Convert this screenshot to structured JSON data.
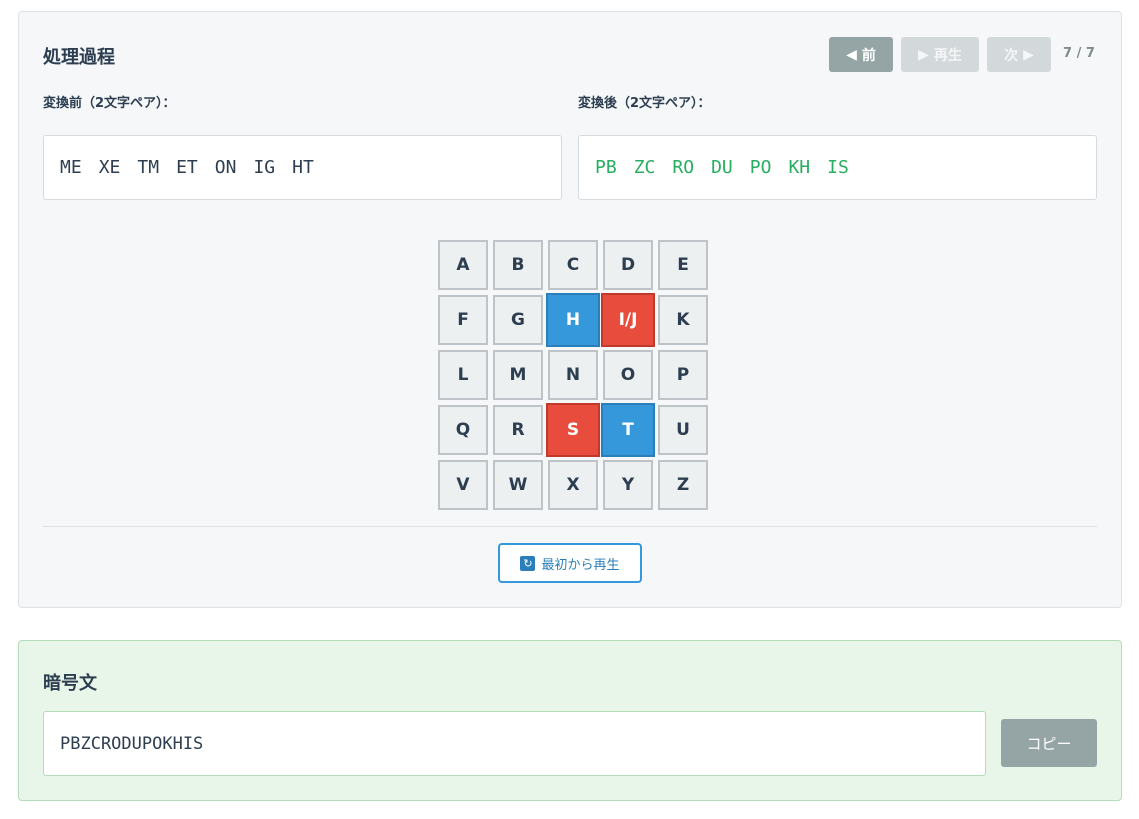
{
  "process": {
    "title": "処理過程",
    "prev_label": "前",
    "play_label": "再生",
    "next_label": "次",
    "counter": "7 / 7",
    "before_label": "変換前（2文字ペア）：",
    "after_label": "変換後（2文字ペア）：",
    "before_pairs": [
      "ME",
      "XE",
      "TM",
      "ET",
      "ON",
      "IG",
      "HT"
    ],
    "after_pairs": [
      "PB",
      "ZC",
      "RO",
      "DU",
      "PO",
      "KH",
      "IS"
    ],
    "grid": [
      [
        "A",
        "B",
        "C",
        "D",
        "E"
      ],
      [
        "F",
        "G",
        "H",
        "I/J",
        "K"
      ],
      [
        "L",
        "M",
        "N",
        "O",
        "P"
      ],
      [
        "Q",
        "R",
        "S",
        "T",
        "U"
      ],
      [
        "V",
        "W",
        "X",
        "Y",
        "Z"
      ]
    ],
    "highlight_blue": [
      "H",
      "T"
    ],
    "highlight_red": [
      "I/J",
      "S"
    ],
    "replay_label": "最初から再生"
  },
  "cipher": {
    "title": "暗号文",
    "value": "PBZCRODUPOKHIS",
    "copy_label": "コピー"
  },
  "colors": {
    "blue": "#3498db",
    "red": "#e74c3c",
    "green_text": "#27ae60",
    "button_gray": "#95a5a6"
  }
}
